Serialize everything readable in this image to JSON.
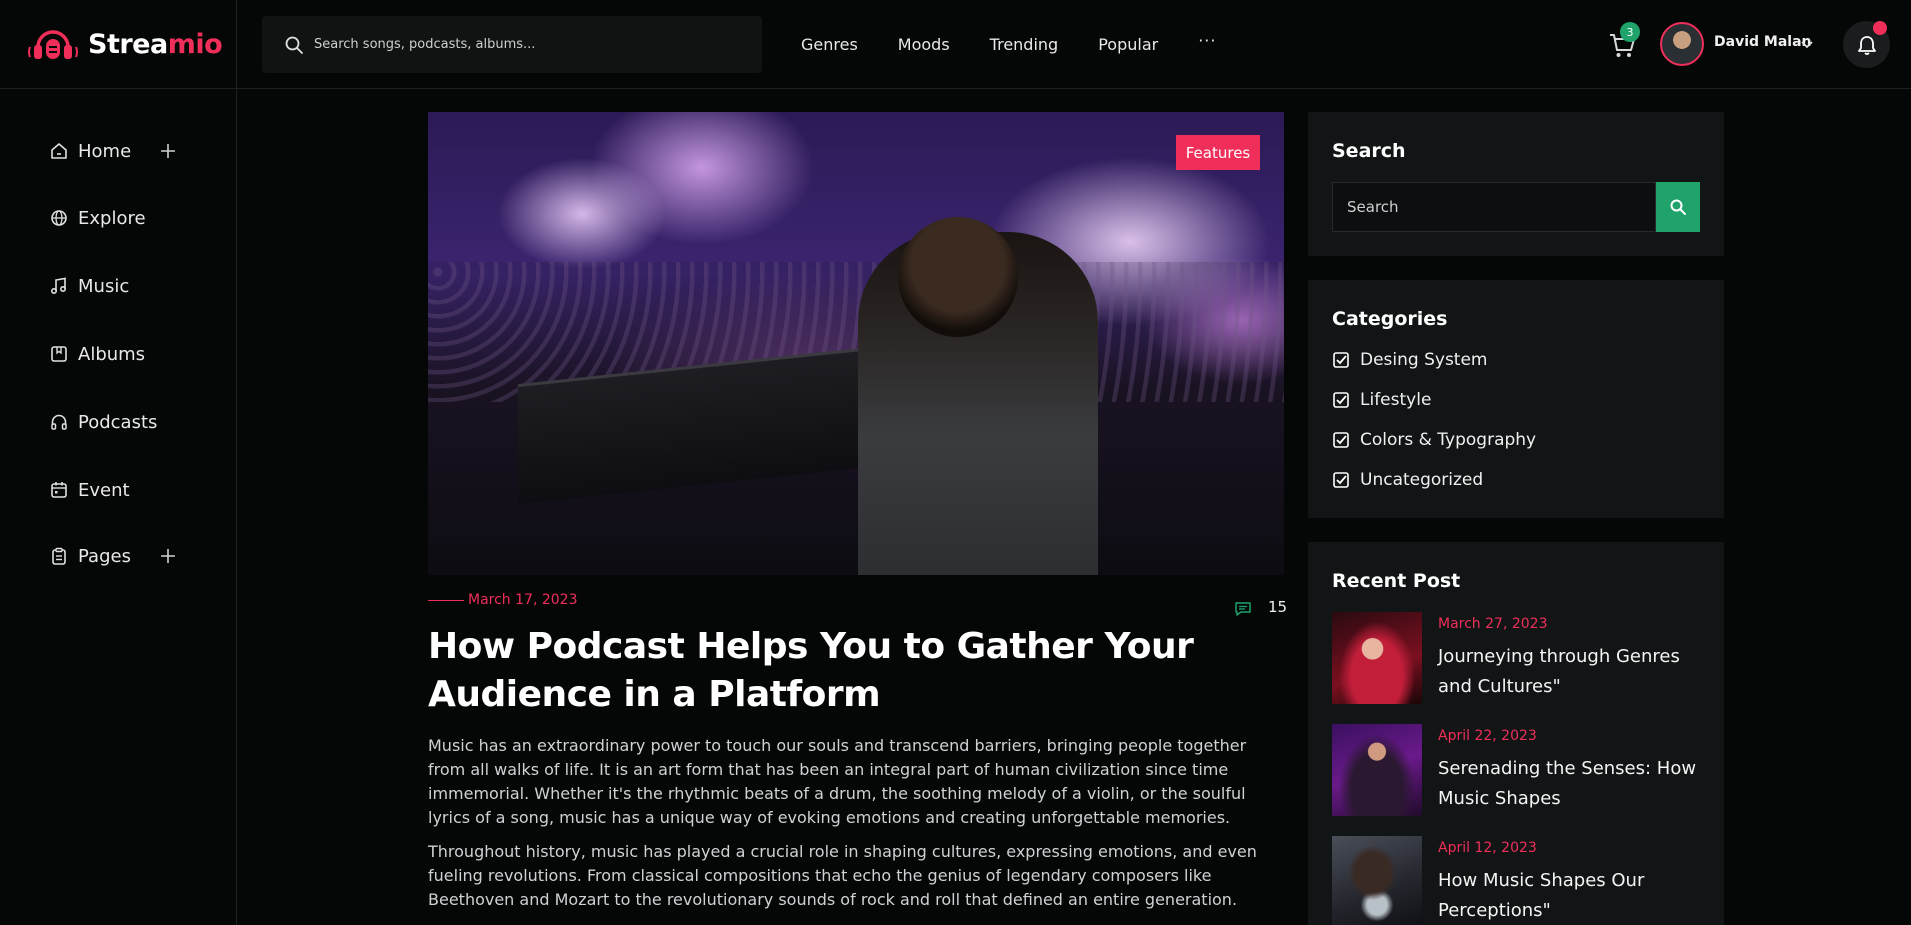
{
  "brand": {
    "name_part1": "Strea",
    "name_part2": "mio",
    "accent": "#ef2f5a"
  },
  "header": {
    "search_placeholder": "Search songs, podcasts, albums...",
    "nav": [
      "Genres",
      "Moods",
      "Trending",
      "Popular"
    ],
    "more_label": "···",
    "cart_count": "3",
    "user_name": "David Malan"
  },
  "sidebar": {
    "items": [
      {
        "label": "Home",
        "icon": "home-icon",
        "expandable": true
      },
      {
        "label": "Explore",
        "icon": "globe-icon",
        "expandable": false
      },
      {
        "label": "Music",
        "icon": "music-note-icon",
        "expandable": false
      },
      {
        "label": "Albums",
        "icon": "album-icon",
        "expandable": false
      },
      {
        "label": "Podcasts",
        "icon": "headphones-icon",
        "expandable": false
      },
      {
        "label": "Event",
        "icon": "calendar-icon",
        "expandable": false
      },
      {
        "label": "Pages",
        "icon": "clipboard-icon",
        "expandable": true
      }
    ]
  },
  "article": {
    "badge": "Features",
    "date": "March 17, 2023",
    "comments": "15",
    "title": "How Podcast Helps You to Gather Your Audience in a Platform",
    "paragraphs": [
      "Music has an extraordinary power to touch our souls and transcend barriers, bringing people together from all walks of life. It is an art form that has been an integral part of human civilization since time immemorial. Whether it's the rhythmic beats of a drum, the soothing melody of a violin, or the soulful lyrics of a song, music has a unique way of evoking emotions and creating unforgettable memories.",
      "Throughout history, music has played a crucial role in shaping cultures, expressing emotions, and even fueling revolutions. From classical compositions that echo the genius of legendary composers like Beethoven and Mozart to the revolutionary sounds of rock and roll that defined an entire generation."
    ]
  },
  "widgets": {
    "search": {
      "title": "Search",
      "placeholder": "Search",
      "button_color": "#1fa36b"
    },
    "categories": {
      "title": "Categories",
      "items": [
        "Desing System",
        "Lifestyle",
        "Colors & Typography",
        "Uncategorized"
      ]
    },
    "recent": {
      "title": "Recent Post",
      "posts": [
        {
          "date": "March 27, 2023",
          "title": "Journeying through Genres and Cultures\""
        },
        {
          "date": "April 22, 2023",
          "title": "Serenading the Senses: How Music Shapes"
        },
        {
          "date": "April 12, 2023",
          "title": "How Music Shapes Our Perceptions\""
        }
      ]
    }
  }
}
